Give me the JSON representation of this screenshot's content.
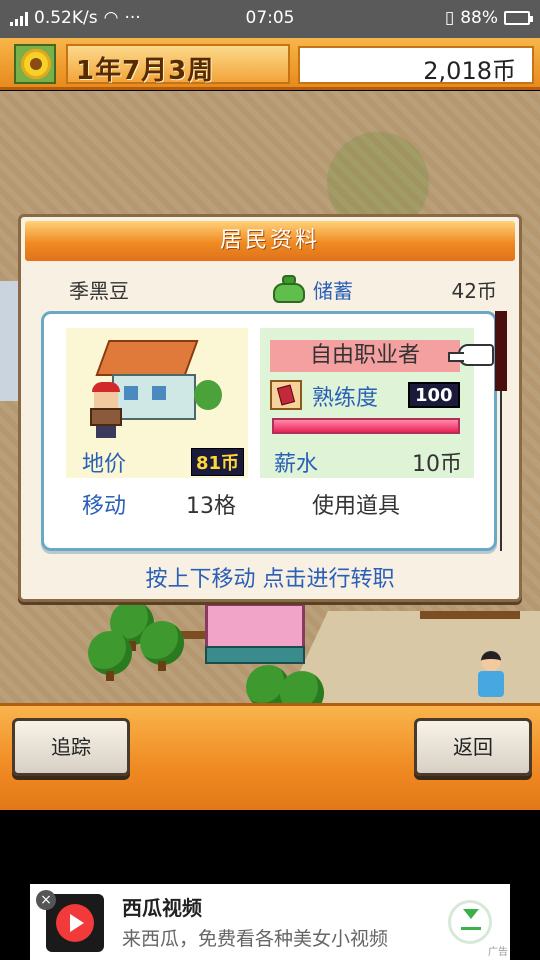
{
  "status_bar": {
    "speed": "0.52K/s",
    "more": "···",
    "time": "07:05",
    "battery": "88%"
  },
  "header": {
    "date": "1年7月3周",
    "coins": "2,018币"
  },
  "dialog": {
    "title": "居民资料",
    "resident_name": "季黑豆",
    "savings_label": "储蓄",
    "savings_value": "42币",
    "land_label": "地价",
    "land_value": "81币",
    "job_name": "自由职业者",
    "skill_label": "熟练度",
    "skill_value": "100",
    "skill_progress": 1.0,
    "salary_label": "薪水",
    "salary_value": "10币",
    "move_label": "移动",
    "move_value": "13格",
    "use_item": "使用道具",
    "hint": "按上下移动 点击进行转职"
  },
  "buttons": {
    "track": "追踪",
    "back": "返回"
  },
  "ad": {
    "title": "西瓜视频",
    "description": "来西瓜，免费看各种美女小视频",
    "tag": "广告"
  },
  "icons": {
    "header": "sunflower-icon",
    "savings": "purse-icon",
    "skill": "book-icon",
    "job_pointer": "pointing-hand-icon"
  }
}
